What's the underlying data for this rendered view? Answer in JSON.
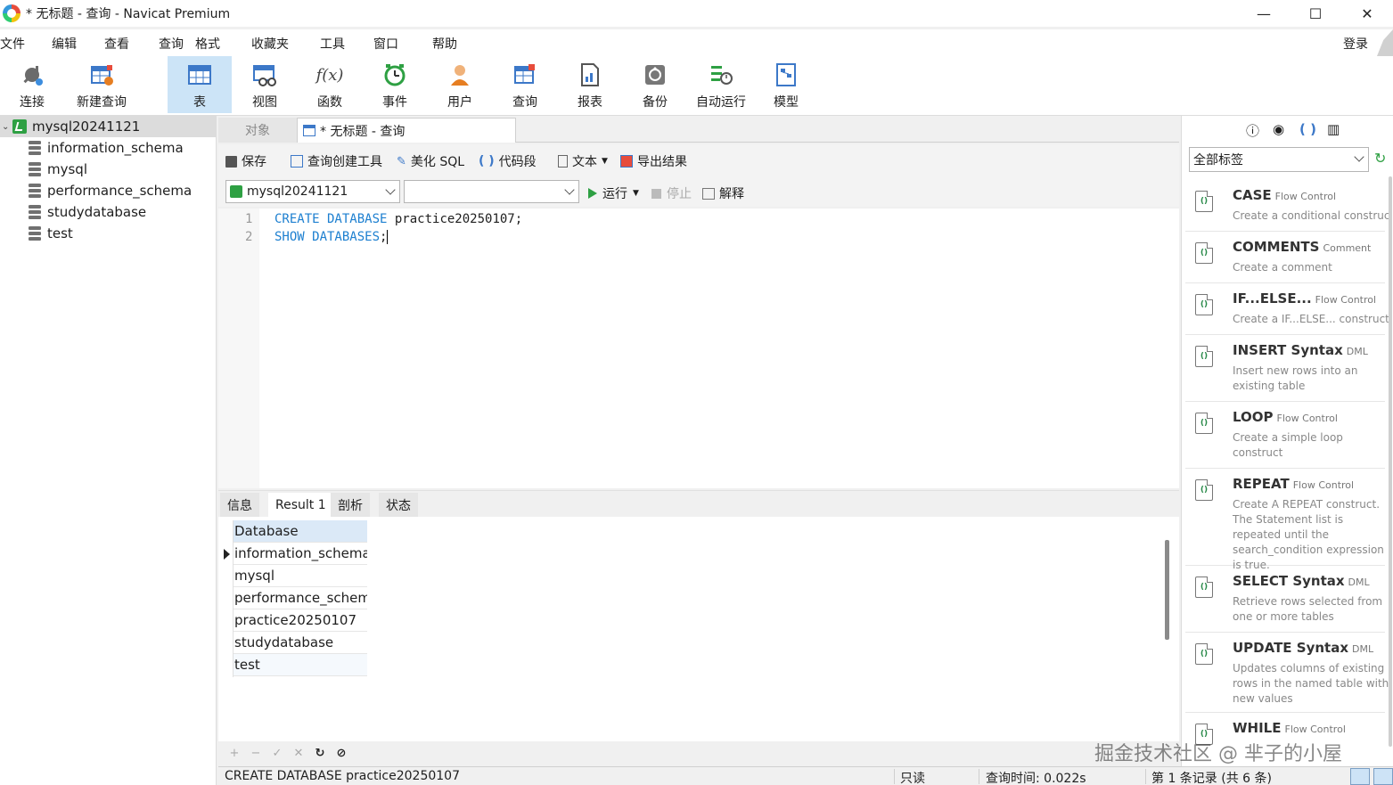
{
  "window": {
    "title": "* 无标题 - 查询 - Navicat Premium",
    "minimize": "—",
    "maximize": "☐",
    "close": "✕"
  },
  "menu": {
    "items": [
      "文件",
      "编辑",
      "查看",
      "查询",
      "格式",
      "收藏夹",
      "工具",
      "窗口",
      "帮助"
    ],
    "login": "登录"
  },
  "toolbar": {
    "items": [
      "连接",
      "新建查询",
      "表",
      "视图",
      "函数",
      "事件",
      "用户",
      "查询",
      "报表",
      "备份",
      "自动运行",
      "模型"
    ],
    "function_glyph": "f(x)"
  },
  "tree": {
    "connection": "mysql20241121",
    "databases": [
      "information_schema",
      "mysql",
      "performance_schema",
      "studydatabase",
      "test"
    ]
  },
  "tabs": {
    "objects": "对象",
    "query": "* 无标题 - 查询"
  },
  "query_toolbar": {
    "save": "保存",
    "builder": "查询创建工具",
    "beautify": "美化 SQL",
    "snippet": "代码段",
    "text": "文本",
    "export": "导出结果"
  },
  "run_bar": {
    "connection": "mysql20241121",
    "database": "",
    "run": "运行",
    "stop": "停止",
    "explain": "解释"
  },
  "editor": {
    "lines": [
      {
        "num": "1",
        "kw": "CREATE DATABASE",
        "rest": " practice20250107;"
      },
      {
        "num": "2",
        "kw": "SHOW DATABASES",
        "rest": ";"
      }
    ]
  },
  "result_tabs": [
    "信息",
    "Result 1",
    "剖析",
    "状态"
  ],
  "result": {
    "header": "Database",
    "rows": [
      "information_schema",
      "mysql",
      "performance_schem",
      "practice20250107",
      "studydatabase",
      "test"
    ]
  },
  "grid_tools": [
    "+",
    "−",
    "✓",
    "✕",
    "↻",
    "⊘"
  ],
  "status": {
    "sql": "CREATE DATABASE practice20250107",
    "mode": "只读",
    "time": "查询时间: 0.022s",
    "records": "第 1 条记录 (共 6 条)"
  },
  "right_panel": {
    "tag_select": "全部标签",
    "snippets": [
      {
        "name": "CASE",
        "cat": "Flow Control",
        "desc": "Create a conditional construct"
      },
      {
        "name": "COMMENTS",
        "cat": "Comment",
        "desc": "Create a comment"
      },
      {
        "name": "IF...ELSE...",
        "cat": "Flow Control",
        "desc": "Create a IF...ELSE... construct"
      },
      {
        "name": "INSERT Syntax",
        "cat": "DML",
        "desc": "Insert new rows into an existing table"
      },
      {
        "name": "LOOP",
        "cat": "Flow Control",
        "desc": "Create a simple loop construct"
      },
      {
        "name": "REPEAT",
        "cat": "Flow Control",
        "desc": "Create A REPEAT construct. The Statement list is repeated until the search_condition expression is true."
      },
      {
        "name": "SELECT Syntax",
        "cat": "DML",
        "desc": "Retrieve rows selected from one or more tables"
      },
      {
        "name": "UPDATE Syntax",
        "cat": "DML",
        "desc": "Updates columns of existing rows in the named table with new values"
      },
      {
        "name": "WHILE",
        "cat": "Flow Control",
        "desc": ""
      }
    ]
  },
  "watermark": "掘金技术社区 @ 芈子的小屋",
  "colors": {
    "accent": "#cce4f7",
    "keyword": "#1c7fd0",
    "header": "#dbe9f7"
  }
}
